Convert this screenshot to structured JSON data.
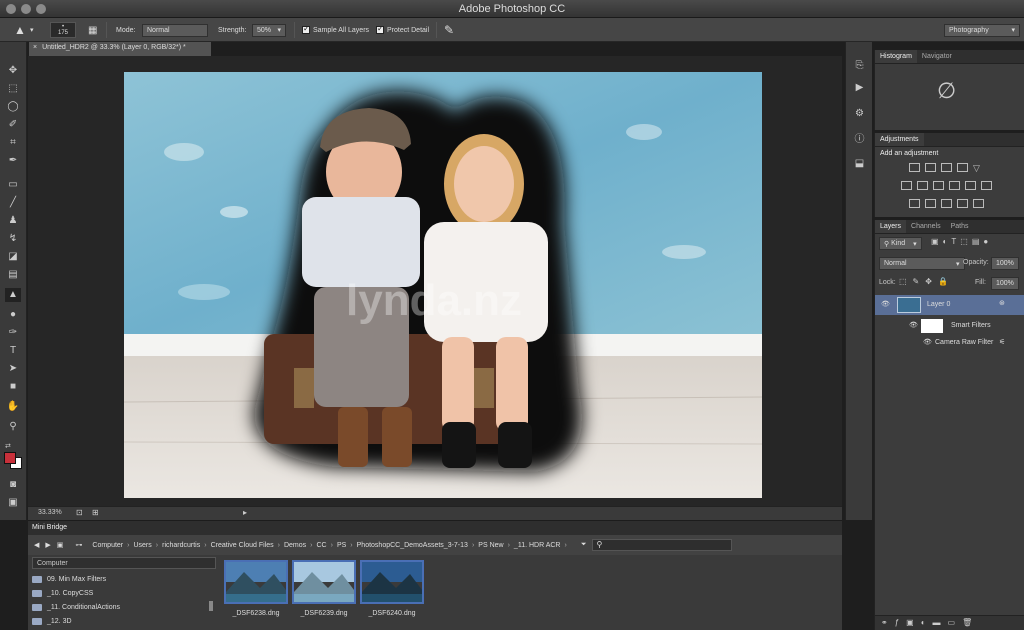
{
  "window": {
    "title": "Adobe Photoshop CC"
  },
  "options": {
    "brush_size": "175",
    "mode_label": "Mode:",
    "mode_value": "Normal",
    "strength_label": "Strength:",
    "strength_value": "50%",
    "sample_all_layers": "Sample All Layers",
    "protect_detail": "Protect Detail",
    "workspace": "Photography"
  },
  "document": {
    "tab_title": "Untitled_HDR2 @ 33.3% (Layer 0, RGB/32*) *",
    "zoom": "33.33%",
    "watermark": "lynda.nz"
  },
  "panels": {
    "top_tabs": [
      "Histogram",
      "Navigator"
    ],
    "adjustments_tab": "Adjustments",
    "add_adjustment": "Add an adjustment",
    "layers_tabs": [
      "Layers",
      "Channels",
      "Paths"
    ],
    "kind_filter": "Kind",
    "blend_mode": "Normal",
    "opacity_label": "Opacity:",
    "opacity_value": "100%",
    "lock_label": "Lock:",
    "fill_label": "Fill:",
    "fill_value": "100%",
    "layers": [
      {
        "name": "Layer 0"
      },
      {
        "name": "Smart Filters"
      },
      {
        "name": "Camera Raw Filter"
      }
    ]
  },
  "bridge": {
    "title": "Mini Bridge",
    "breadcrumbs": [
      "Computer",
      "Users",
      "richardcurtis",
      "Creative Cloud Files",
      "Demos",
      "CC",
      "PS",
      "PhotoshopCC_DemoAssets_3-7-13",
      "PS New",
      "_11. HDR ACR"
    ],
    "folder_header": "Computer",
    "folders": [
      "09. Min Max Filters",
      "_10. CopyCSS",
      "_11. ConditionalActions",
      "_12. 3D"
    ],
    "files": [
      "_DSF6238.dng",
      "_DSF6239.dng",
      "_DSF6240.dng"
    ]
  },
  "colors": {
    "foreground": "#c8303a",
    "background": "#ffffff",
    "accent": "#4a6fb5"
  }
}
